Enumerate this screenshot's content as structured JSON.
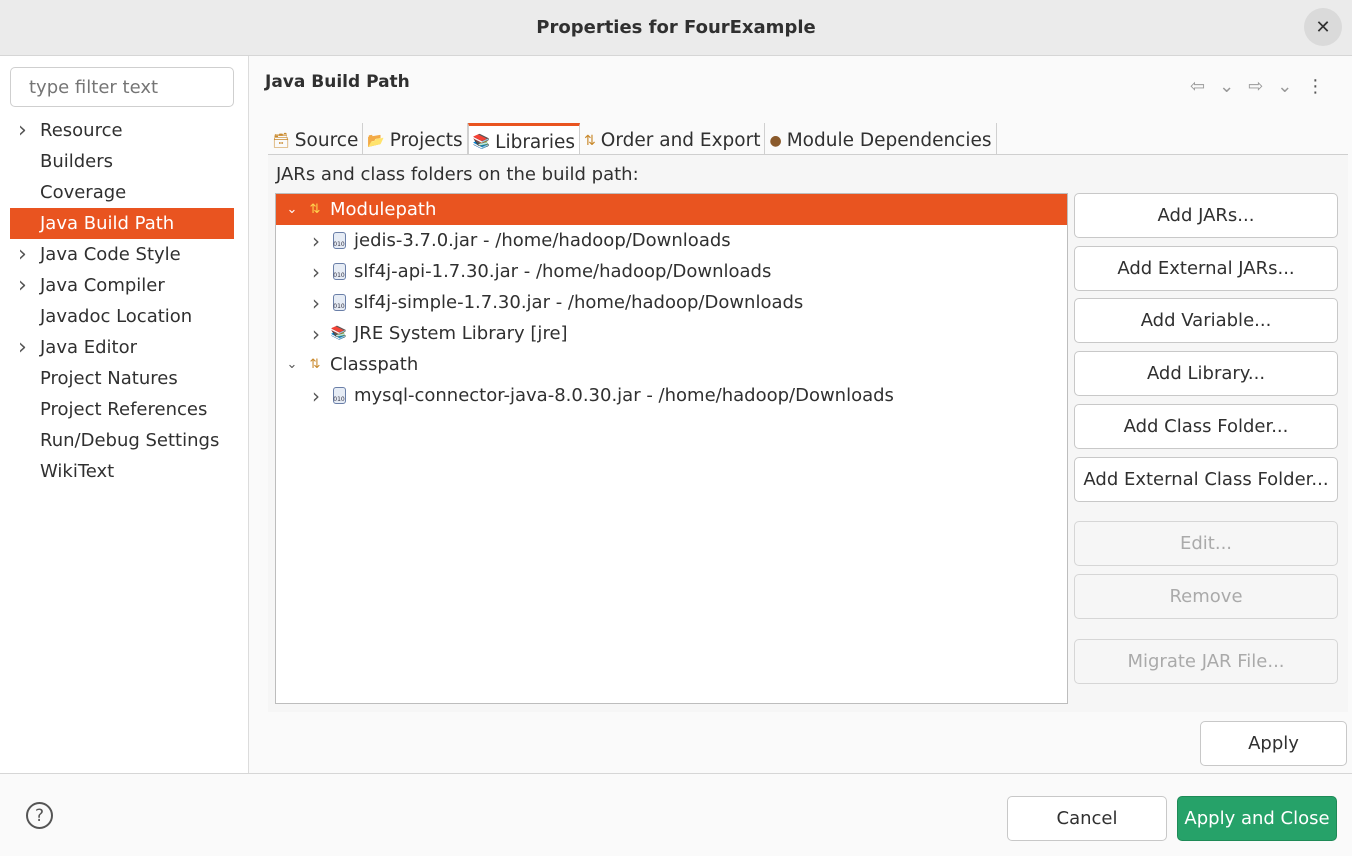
{
  "window": {
    "title": "Properties for FourExample",
    "close": "✕"
  },
  "sidebar": {
    "filter_placeholder": "type filter text",
    "items": [
      {
        "label": "Resource",
        "expandable": true
      },
      {
        "label": "Builders"
      },
      {
        "label": "Coverage"
      },
      {
        "label": "Java Build Path",
        "selected": true
      },
      {
        "label": "Java Code Style",
        "expandable": true
      },
      {
        "label": "Java Compiler",
        "expandable": true
      },
      {
        "label": "Javadoc Location"
      },
      {
        "label": "Java Editor",
        "expandable": true
      },
      {
        "label": "Project Natures"
      },
      {
        "label": "Project References"
      },
      {
        "label": "Run/Debug Settings"
      },
      {
        "label": "WikiText"
      }
    ]
  },
  "main": {
    "title": "Java Build Path",
    "tabs": [
      {
        "label": "Source",
        "icon": "source-icon"
      },
      {
        "label": "Projects",
        "icon": "folder-icon"
      },
      {
        "label": "Libraries",
        "icon": "library-icon",
        "active": true
      },
      {
        "label": "Order and Export",
        "icon": "order-icon"
      },
      {
        "label": "Module Dependencies",
        "icon": "module-icon"
      }
    ],
    "tree_label": "JARs and class folders on the build path:",
    "tree": [
      {
        "label": "Modulepath",
        "level": 0,
        "expanded": true,
        "selected": true,
        "icon": "modulepath-icon"
      },
      {
        "label": "jedis-3.7.0.jar - /home/hadoop/Downloads",
        "level": 1,
        "icon": "jar-icon"
      },
      {
        "label": "slf4j-api-1.7.30.jar - /home/hadoop/Downloads",
        "level": 1,
        "icon": "jar-icon"
      },
      {
        "label": "slf4j-simple-1.7.30.jar - /home/hadoop/Downloads",
        "level": 1,
        "icon": "jar-icon"
      },
      {
        "label": "JRE System Library [jre]",
        "level": 1,
        "icon": "library-icon"
      },
      {
        "label": "Classpath",
        "level": 0,
        "expanded": true,
        "icon": "classpath-icon"
      },
      {
        "label": "mysql-connector-java-8.0.30.jar - /home/hadoop/Downloads",
        "level": 1,
        "icon": "jar-icon"
      }
    ],
    "buttons": [
      {
        "label": "Add JARs..."
      },
      {
        "label": "Add External JARs..."
      },
      {
        "label": "Add Variable..."
      },
      {
        "label": "Add Library..."
      },
      {
        "label": "Add Class Folder..."
      },
      {
        "label": "Add External Class Folder..."
      },
      {
        "label": "Edit...",
        "disabled": true
      },
      {
        "label": "Remove",
        "disabled": true
      },
      {
        "label": "Migrate JAR File...",
        "disabled": true
      }
    ],
    "apply": "Apply"
  },
  "footer": {
    "help": "?",
    "cancel": "Cancel",
    "apply_close": "Apply and Close"
  },
  "colors": {
    "accent": "#e95420",
    "primary": "#26a269"
  }
}
